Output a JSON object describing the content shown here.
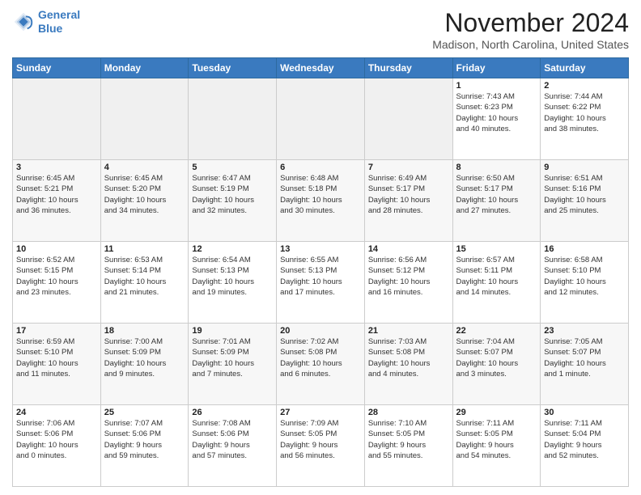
{
  "header": {
    "logo_line1": "General",
    "logo_line2": "Blue",
    "month": "November 2024",
    "location": "Madison, North Carolina, United States"
  },
  "weekdays": [
    "Sunday",
    "Monday",
    "Tuesday",
    "Wednesday",
    "Thursday",
    "Friday",
    "Saturday"
  ],
  "weeks": [
    [
      {
        "day": "",
        "info": ""
      },
      {
        "day": "",
        "info": ""
      },
      {
        "day": "",
        "info": ""
      },
      {
        "day": "",
        "info": ""
      },
      {
        "day": "",
        "info": ""
      },
      {
        "day": "1",
        "info": "Sunrise: 7:43 AM\nSunset: 6:23 PM\nDaylight: 10 hours\nand 40 minutes."
      },
      {
        "day": "2",
        "info": "Sunrise: 7:44 AM\nSunset: 6:22 PM\nDaylight: 10 hours\nand 38 minutes."
      }
    ],
    [
      {
        "day": "3",
        "info": "Sunrise: 6:45 AM\nSunset: 5:21 PM\nDaylight: 10 hours\nand 36 minutes."
      },
      {
        "day": "4",
        "info": "Sunrise: 6:45 AM\nSunset: 5:20 PM\nDaylight: 10 hours\nand 34 minutes."
      },
      {
        "day": "5",
        "info": "Sunrise: 6:47 AM\nSunset: 5:19 PM\nDaylight: 10 hours\nand 32 minutes."
      },
      {
        "day": "6",
        "info": "Sunrise: 6:48 AM\nSunset: 5:18 PM\nDaylight: 10 hours\nand 30 minutes."
      },
      {
        "day": "7",
        "info": "Sunrise: 6:49 AM\nSunset: 5:17 PM\nDaylight: 10 hours\nand 28 minutes."
      },
      {
        "day": "8",
        "info": "Sunrise: 6:50 AM\nSunset: 5:17 PM\nDaylight: 10 hours\nand 27 minutes."
      },
      {
        "day": "9",
        "info": "Sunrise: 6:51 AM\nSunset: 5:16 PM\nDaylight: 10 hours\nand 25 minutes."
      }
    ],
    [
      {
        "day": "10",
        "info": "Sunrise: 6:52 AM\nSunset: 5:15 PM\nDaylight: 10 hours\nand 23 minutes."
      },
      {
        "day": "11",
        "info": "Sunrise: 6:53 AM\nSunset: 5:14 PM\nDaylight: 10 hours\nand 21 minutes."
      },
      {
        "day": "12",
        "info": "Sunrise: 6:54 AM\nSunset: 5:13 PM\nDaylight: 10 hours\nand 19 minutes."
      },
      {
        "day": "13",
        "info": "Sunrise: 6:55 AM\nSunset: 5:13 PM\nDaylight: 10 hours\nand 17 minutes."
      },
      {
        "day": "14",
        "info": "Sunrise: 6:56 AM\nSunset: 5:12 PM\nDaylight: 10 hours\nand 16 minutes."
      },
      {
        "day": "15",
        "info": "Sunrise: 6:57 AM\nSunset: 5:11 PM\nDaylight: 10 hours\nand 14 minutes."
      },
      {
        "day": "16",
        "info": "Sunrise: 6:58 AM\nSunset: 5:10 PM\nDaylight: 10 hours\nand 12 minutes."
      }
    ],
    [
      {
        "day": "17",
        "info": "Sunrise: 6:59 AM\nSunset: 5:10 PM\nDaylight: 10 hours\nand 11 minutes."
      },
      {
        "day": "18",
        "info": "Sunrise: 7:00 AM\nSunset: 5:09 PM\nDaylight: 10 hours\nand 9 minutes."
      },
      {
        "day": "19",
        "info": "Sunrise: 7:01 AM\nSunset: 5:09 PM\nDaylight: 10 hours\nand 7 minutes."
      },
      {
        "day": "20",
        "info": "Sunrise: 7:02 AM\nSunset: 5:08 PM\nDaylight: 10 hours\nand 6 minutes."
      },
      {
        "day": "21",
        "info": "Sunrise: 7:03 AM\nSunset: 5:08 PM\nDaylight: 10 hours\nand 4 minutes."
      },
      {
        "day": "22",
        "info": "Sunrise: 7:04 AM\nSunset: 5:07 PM\nDaylight: 10 hours\nand 3 minutes."
      },
      {
        "day": "23",
        "info": "Sunrise: 7:05 AM\nSunset: 5:07 PM\nDaylight: 10 hours\nand 1 minute."
      }
    ],
    [
      {
        "day": "24",
        "info": "Sunrise: 7:06 AM\nSunset: 5:06 PM\nDaylight: 10 hours\nand 0 minutes."
      },
      {
        "day": "25",
        "info": "Sunrise: 7:07 AM\nSunset: 5:06 PM\nDaylight: 9 hours\nand 59 minutes."
      },
      {
        "day": "26",
        "info": "Sunrise: 7:08 AM\nSunset: 5:06 PM\nDaylight: 9 hours\nand 57 minutes."
      },
      {
        "day": "27",
        "info": "Sunrise: 7:09 AM\nSunset: 5:05 PM\nDaylight: 9 hours\nand 56 minutes."
      },
      {
        "day": "28",
        "info": "Sunrise: 7:10 AM\nSunset: 5:05 PM\nDaylight: 9 hours\nand 55 minutes."
      },
      {
        "day": "29",
        "info": "Sunrise: 7:11 AM\nSunset: 5:05 PM\nDaylight: 9 hours\nand 54 minutes."
      },
      {
        "day": "30",
        "info": "Sunrise: 7:11 AM\nSunset: 5:04 PM\nDaylight: 9 hours\nand 52 minutes."
      }
    ]
  ]
}
